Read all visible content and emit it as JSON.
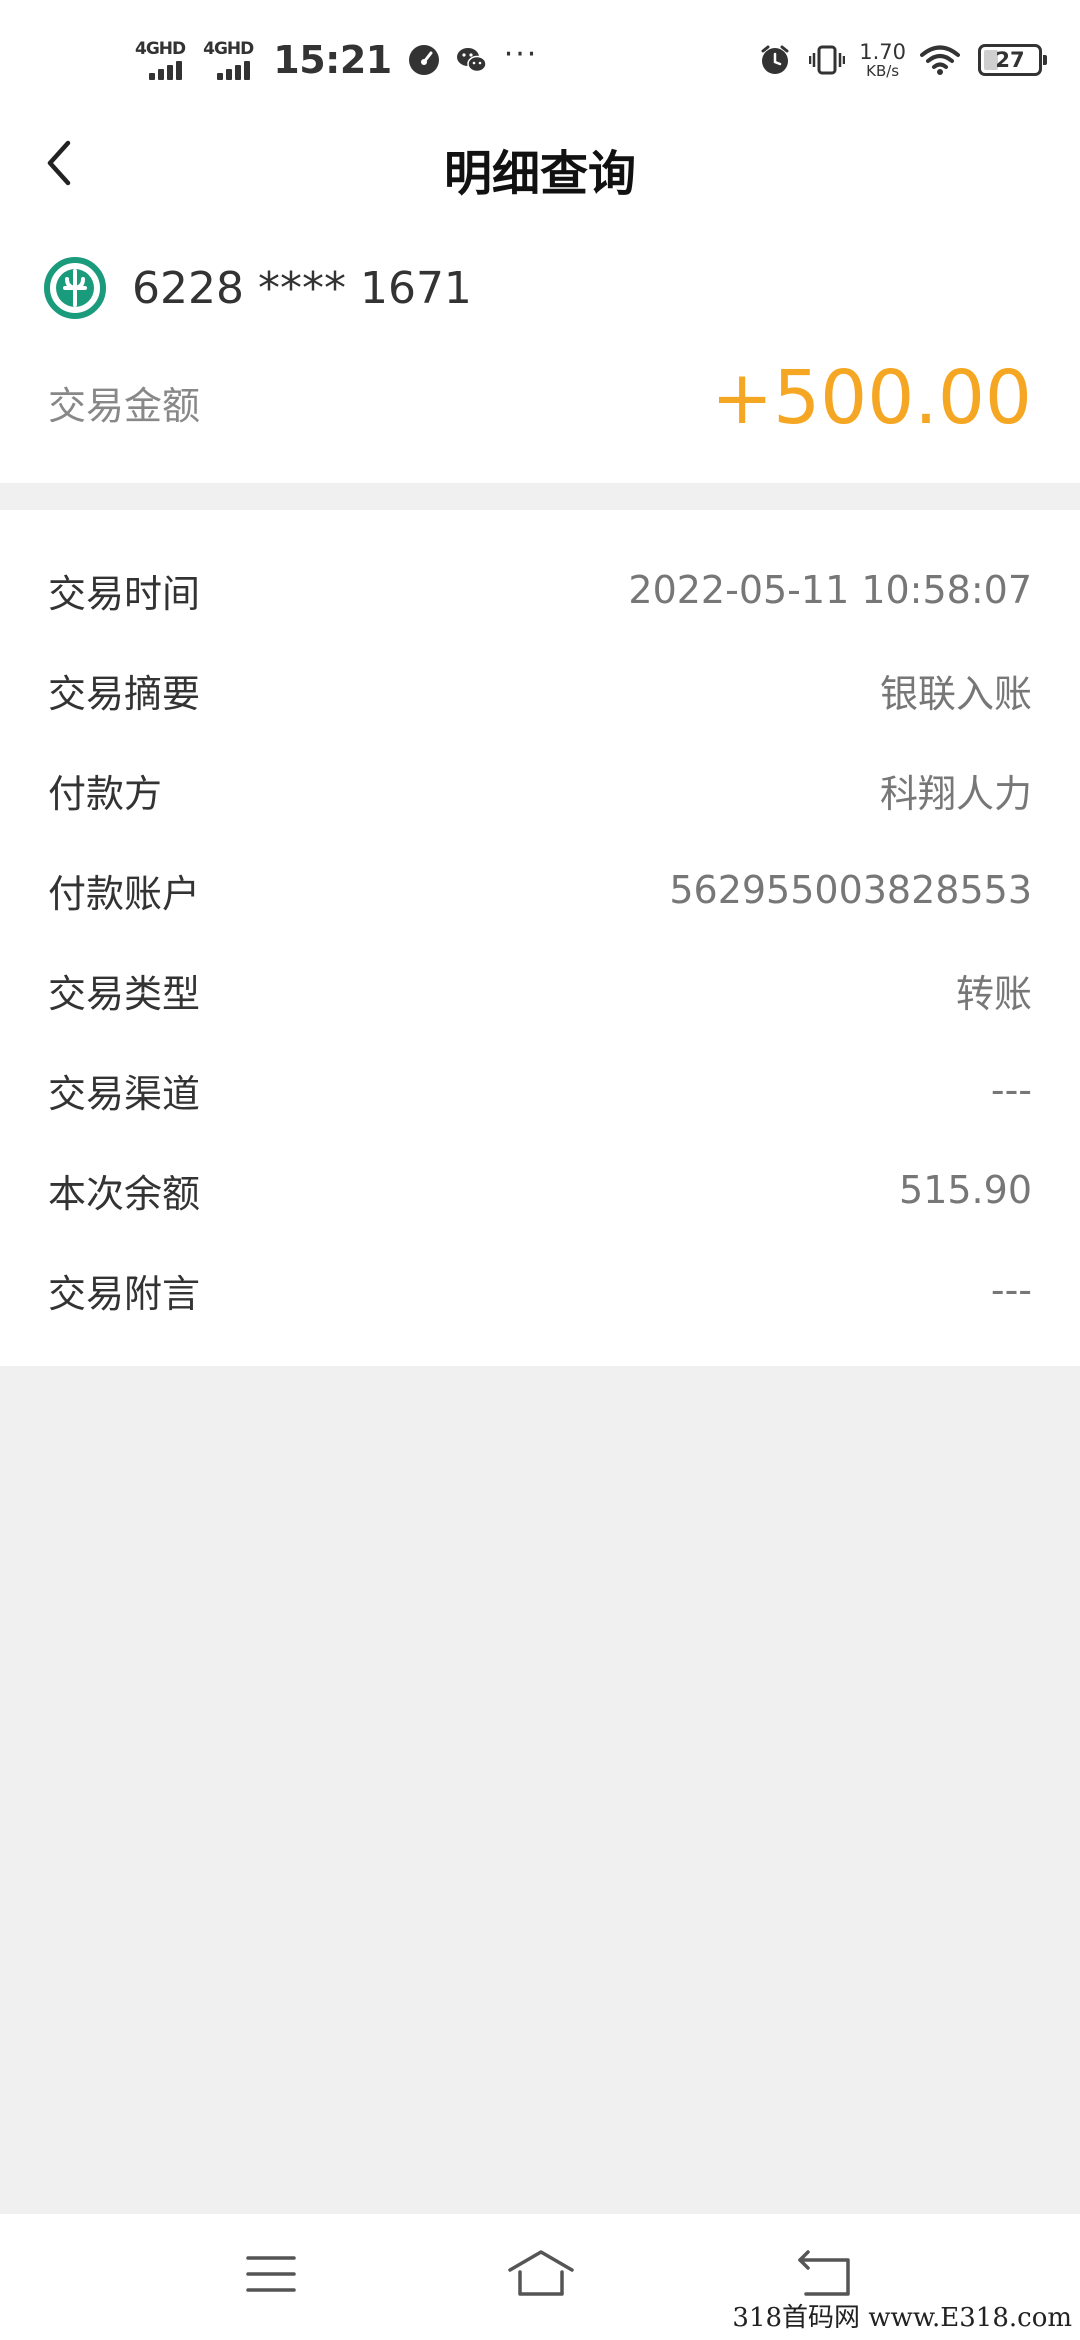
{
  "status_bar": {
    "net1": "4GHD",
    "net2": "4GHD",
    "time": "15:21",
    "more": "···",
    "speed_value": "1.70",
    "speed_unit": "KB/s",
    "battery": "27"
  },
  "header": {
    "title": "明细查询"
  },
  "summary": {
    "card_number": "6228 **** 1671",
    "amount_label": "交易金额",
    "amount_value": "+500.00",
    "amount_color": "#f5a623",
    "logo_color": "#1a9b7c"
  },
  "details": [
    {
      "label": "交易时间",
      "value": "2022-05-11 10:58:07"
    },
    {
      "label": "交易摘要",
      "value": "银联入账"
    },
    {
      "label": "付款方",
      "value": "科翔人力"
    },
    {
      "label": "付款账户",
      "value": "562955003828553"
    },
    {
      "label": "交易类型",
      "value": "转账"
    },
    {
      "label": "交易渠道",
      "value": "---"
    },
    {
      "label": "本次余额",
      "value": "515.90"
    },
    {
      "label": "交易附言",
      "value": "---"
    }
  ],
  "nav_bar": {
    "icons": [
      "menu-icon",
      "home-icon",
      "back-icon"
    ]
  },
  "watermark": "318首码网 www.E318.com"
}
